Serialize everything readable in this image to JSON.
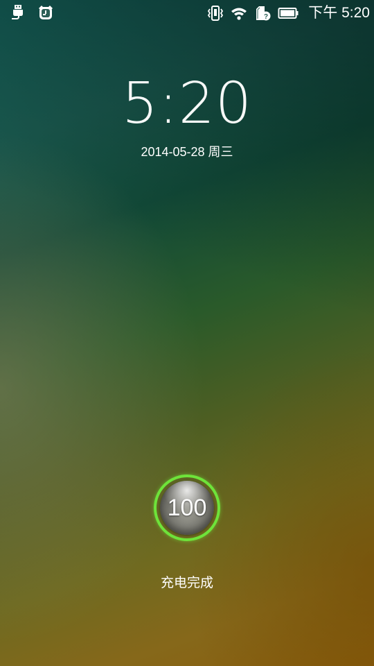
{
  "status_bar": {
    "left_icons": [
      "usb-icon",
      "alarm-clock-icon"
    ],
    "right_icons": [
      "vibrate-icon",
      "wifi-icon",
      "sim-unknown-icon",
      "battery-icon"
    ],
    "time": "下午 5:20"
  },
  "lockscreen": {
    "clock": "5:20",
    "date": "2014-05-28 周三"
  },
  "battery": {
    "level": "100",
    "status_text": "充电完成",
    "ring_color": "#6ee33a"
  }
}
